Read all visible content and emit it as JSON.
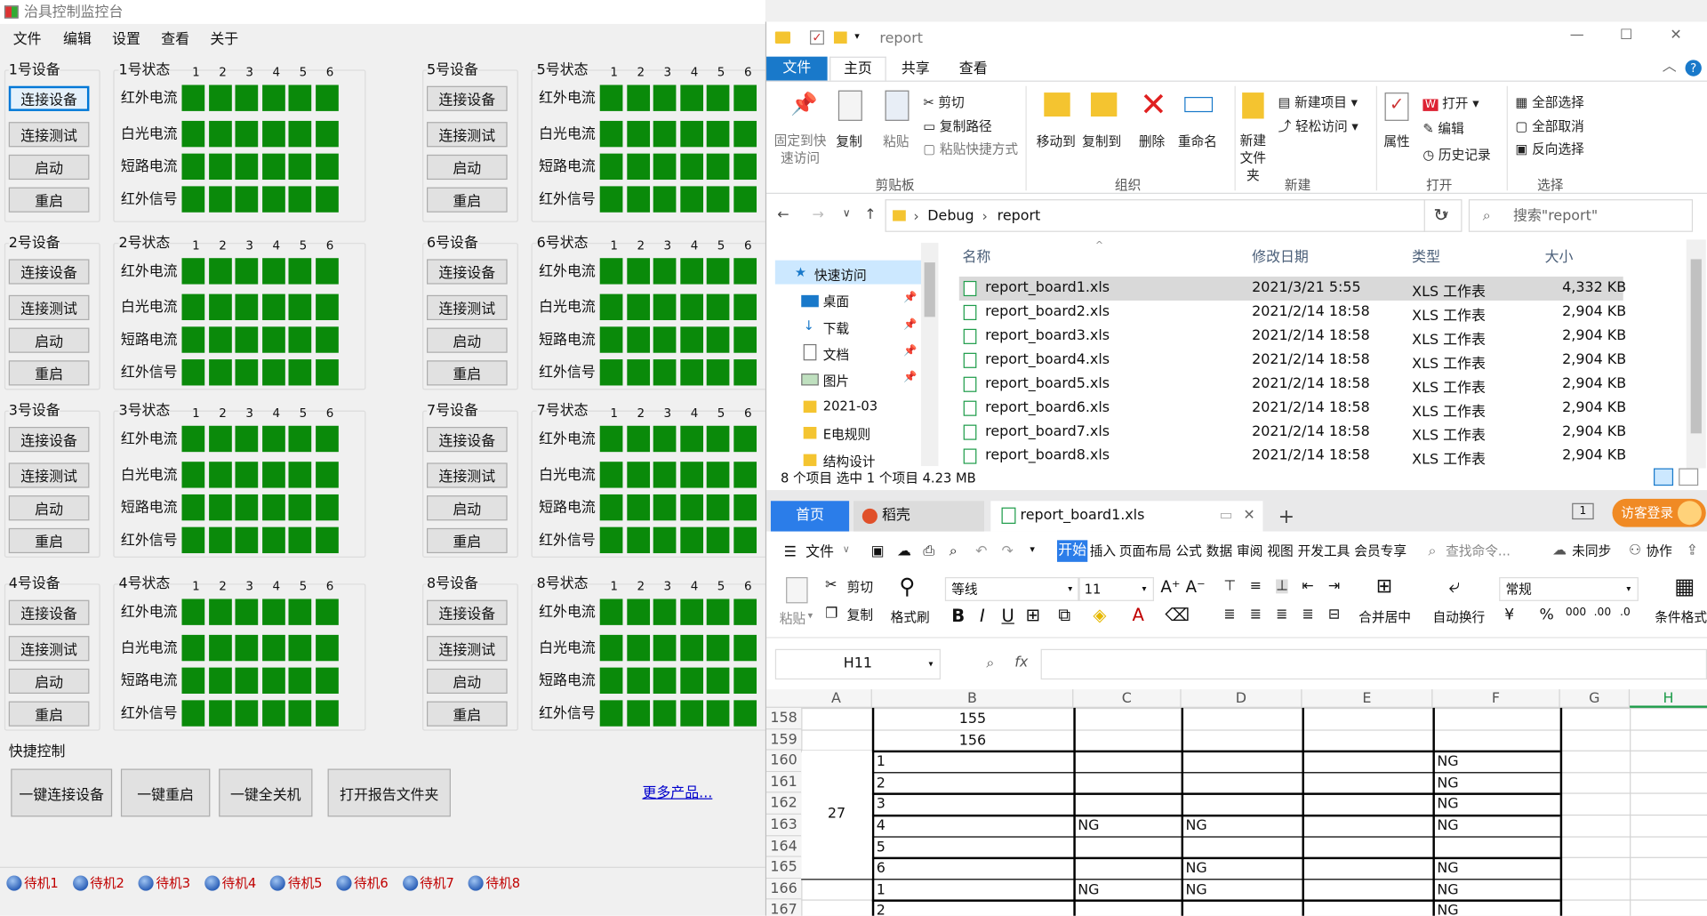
{
  "app": {
    "title": "治具控制监控台",
    "menu": [
      "文件",
      "编辑",
      "设置",
      "查看",
      "关于"
    ]
  },
  "colnums": [
    "1",
    "2",
    "3",
    "4",
    "5",
    "6"
  ],
  "rowlabels": [
    "红外电流",
    "白光电流",
    "短路电流",
    "红外信号"
  ],
  "btns": [
    "连接设备",
    "连接测试",
    "启动",
    "重启"
  ],
  "devices": [
    {
      "dev": "1号设备",
      "state": "1号状态"
    },
    {
      "dev": "5号设备",
      "state": "5号状态"
    },
    {
      "dev": "2号设备",
      "state": "2号状态"
    },
    {
      "dev": "6号设备",
      "state": "6号状态"
    },
    {
      "dev": "3号设备",
      "state": "3号状态"
    },
    {
      "dev": "7号设备",
      "state": "7号状态"
    },
    {
      "dev": "4号设备",
      "state": "4号状态"
    },
    {
      "dev": "8号设备",
      "state": "8号状态"
    }
  ],
  "quick": {
    "title": "快捷控制",
    "buttons": [
      "一键连接设备",
      "一键重启",
      "一键全关机",
      "打开报告文件夹"
    ],
    "link": "更多产品..."
  },
  "status": [
    "待机1",
    "待机2",
    "待机3",
    "待机4",
    "待机5",
    "待机6",
    "待机7",
    "待机8"
  ],
  "explorer": {
    "title": "report",
    "tabs": [
      "文件",
      "主页",
      "共享",
      "查看"
    ],
    "ribbon": {
      "pin": "固定到快速访问",
      "copy": "复制",
      "paste": "粘贴",
      "cut": "剪切",
      "copypath": "复制路径",
      "pasteshortcut": "粘贴快捷方式",
      "moveto": "移动到",
      "copyto": "复制到",
      "delete": "删除",
      "rename": "重命名",
      "newfolder": "新建文件夹",
      "newitem": "新建项目",
      "easyaccess": "轻松访问",
      "open": "打开",
      "edit": "编辑",
      "history": "历史记录",
      "props": "属性",
      "selall": "全部选择",
      "selnone": "全部取消",
      "invert": "反向选择",
      "g_clip": "剪贴板",
      "g_org": "组织",
      "g_new": "新建",
      "g_open": "打开",
      "g_sel": "选择"
    },
    "crumbs": [
      "Debug",
      "report"
    ],
    "search": "搜索\"report\"",
    "nav": [
      "快速访问",
      "桌面",
      "下载",
      "文档",
      "图片",
      "2021-03",
      "E电规则",
      "结构设计"
    ],
    "cols": [
      "名称",
      "修改日期",
      "类型",
      "大小"
    ],
    "files": [
      {
        "name": "report_board1.xls",
        "date": "2021/3/21 5:55",
        "type": "XLS 工作表",
        "size": "4,332 KB"
      },
      {
        "name": "report_board2.xls",
        "date": "2021/2/14 18:58",
        "type": "XLS 工作表",
        "size": "2,904 KB"
      },
      {
        "name": "report_board3.xls",
        "date": "2021/2/14 18:58",
        "type": "XLS 工作表",
        "size": "2,904 KB"
      },
      {
        "name": "report_board4.xls",
        "date": "2021/2/14 18:58",
        "type": "XLS 工作表",
        "size": "2,904 KB"
      },
      {
        "name": "report_board5.xls",
        "date": "2021/2/14 18:58",
        "type": "XLS 工作表",
        "size": "2,904 KB"
      },
      {
        "name": "report_board6.xls",
        "date": "2021/2/14 18:58",
        "type": "XLS 工作表",
        "size": "2,904 KB"
      },
      {
        "name": "report_board7.xls",
        "date": "2021/2/14 18:58",
        "type": "XLS 工作表",
        "size": "2,904 KB"
      },
      {
        "name": "report_board8.xls",
        "date": "2021/2/14 18:58",
        "type": "XLS 工作表",
        "size": "2,904 KB"
      }
    ],
    "status": "8 个项目    选中 1 个项目  4.23 MB"
  },
  "wps": {
    "tabs": [
      "首页",
      "稻壳",
      "report_board1.xls"
    ],
    "login": "访客登录",
    "menu": [
      "文件",
      "开始",
      "插入",
      "页面布局",
      "公式",
      "数据",
      "审阅",
      "视图",
      "开发工具",
      "会员专享"
    ],
    "search": "查找命令...",
    "sync": "未同步",
    "collab": "协作",
    "tools": {
      "cut": "剪切",
      "copy": "复制",
      "paste": "粘贴",
      "fmt": "格式刷",
      "font": "等线",
      "size": "11",
      "merge": "合并居中",
      "wrap": "自动换行",
      "numfmt": "常规",
      "cond": "条件格式"
    },
    "cellref": "H11",
    "cols": [
      "A",
      "B",
      "C",
      "D",
      "E",
      "F",
      "G",
      "H"
    ],
    "rows": [
      {
        "n": "158",
        "b": "155",
        "c": "",
        "d": "",
        "f": ""
      },
      {
        "n": "159",
        "b": "156",
        "c": "",
        "d": "",
        "f": ""
      },
      {
        "n": "160",
        "b": "1",
        "c": "",
        "d": "",
        "f": "NG"
      },
      {
        "n": "161",
        "b": "2",
        "c": "",
        "d": "",
        "f": "NG"
      },
      {
        "n": "162",
        "b": "3",
        "c": "",
        "d": "",
        "f": "NG"
      },
      {
        "n": "163",
        "b": "4",
        "c": "NG",
        "d": "NG",
        "f": "NG"
      },
      {
        "n": "164",
        "b": "5",
        "c": "",
        "d": "",
        "f": ""
      },
      {
        "n": "165",
        "b": "6",
        "c": "",
        "d": "NG",
        "f": "NG"
      },
      {
        "n": "166",
        "b": "1",
        "c": "NG",
        "d": "NG",
        "f": "NG"
      },
      {
        "n": "167",
        "b": "2",
        "c": "",
        "d": "",
        "f": "NG"
      }
    ],
    "merged_a": "27"
  },
  "colors": {
    "green": "#0a8a0a",
    "accent": "#0078d7",
    "wps_orange": "#f08a24",
    "ng_red": "#c00000"
  }
}
